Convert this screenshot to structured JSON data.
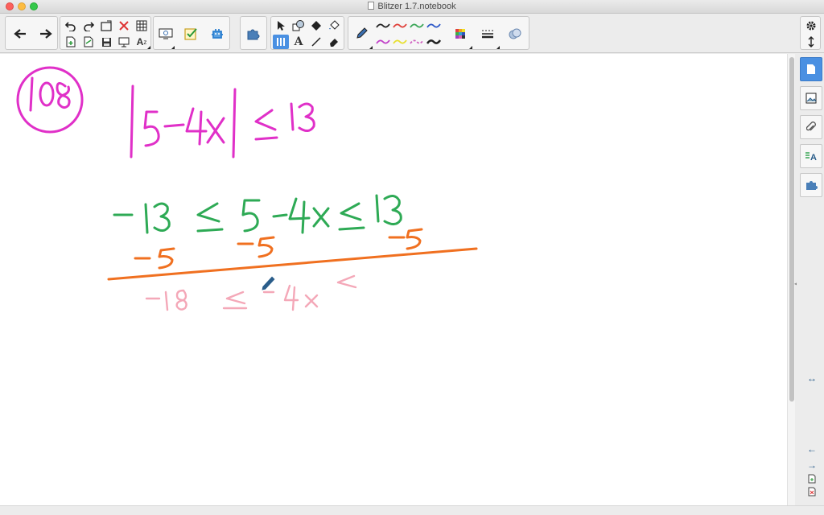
{
  "window": {
    "title": "Blitzer 1.7.notebook"
  },
  "toolbar": {
    "groups": [
      {
        "name": "navigation",
        "buttons": [
          "back-arrow-icon",
          "forward-arrow-icon"
        ]
      },
      {
        "name": "edit",
        "buttons": [
          "undo-icon",
          "redo-icon",
          "screen-shade-icon",
          "delete-icon",
          "table-icon",
          "add-page-icon",
          "paste-icon",
          "save-icon",
          "display-icon",
          "text-format-icon"
        ]
      },
      {
        "name": "tools",
        "buttons": [
          "screen-capture-icon",
          "response-icon",
          "addons-icon"
        ]
      },
      {
        "name": "widgets",
        "buttons": [
          "puzzle-icon"
        ]
      },
      {
        "name": "select",
        "buttons": [
          "select-arrow-icon",
          "shapes-icon",
          "fill-icon",
          "paint-bucket-icon",
          "pens-icon",
          "text-icon",
          "line-icon",
          "eraser-icon"
        ]
      },
      {
        "name": "pens",
        "buttons": [
          "pen-icon"
        ]
      }
    ],
    "pen_colors": [
      "#222222",
      "#e0403a",
      "#3aa657",
      "#2d58c8",
      "#c040c8",
      "#e8e030",
      "#d060c0",
      "#222222"
    ],
    "color_palette_icon": "color-grid-icon",
    "line_style_icon": "line-style-icon",
    "properties_icon": "properties-icon"
  },
  "canvas": {
    "handwriting": {
      "problem_number": "108",
      "line1": "|5−4x| ≤ 13",
      "line2": "−13 ≤ 5−4x ≤ 13",
      "line3": "−5     −5     −5",
      "line4": "−18 ≤ −4x <"
    },
    "ink_colors": {
      "magenta": "#e030c8",
      "green": "#2eaa55",
      "orange": "#f07020",
      "pink": "#f4a8b8"
    }
  },
  "sidepanel": {
    "tabs": [
      "page-sorter-icon",
      "gallery-icon",
      "attachments-icon",
      "properties-tab-icon",
      "addons-tab-icon"
    ],
    "resize_label": "↔",
    "nav": [
      "←",
      "→"
    ]
  }
}
